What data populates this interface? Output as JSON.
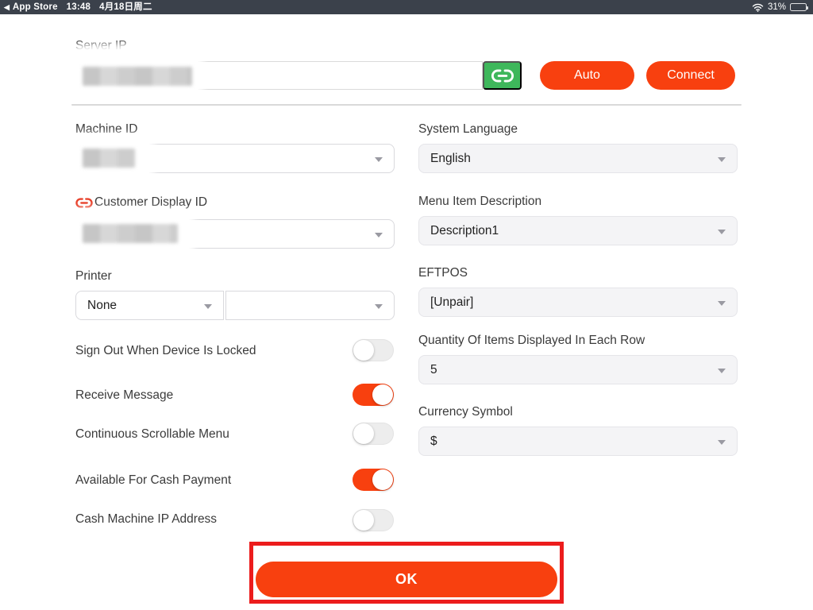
{
  "status_bar": {
    "back_indicator": "◀",
    "back_app": "App Store",
    "time": "13:48",
    "date": "4月18日周二",
    "battery_percent": "31%"
  },
  "colors": {
    "accent_orange": "#f8400f",
    "link_green": "#3eb75b",
    "annotation_red": "#ec1c1c",
    "statusbar_bg": "#3b414b"
  },
  "form": {
    "server_ip": {
      "label": "Server IP",
      "value": "",
      "redacted": true
    },
    "auto_button": "Auto",
    "connect_button": "Connect",
    "machine_id": {
      "label": "Machine ID",
      "value": "",
      "redacted": true
    },
    "customer_display_id": {
      "label": "Customer Display ID",
      "value": "",
      "redacted": true
    },
    "printer": {
      "label": "Printer",
      "value1": "None",
      "value2": ""
    },
    "toggles": [
      {
        "label": "Sign Out When Device Is Locked",
        "on": false
      },
      {
        "label": "Receive Message",
        "on": true
      },
      {
        "label": "Continuous Scrollable Menu",
        "on": false
      },
      {
        "label": "Available For Cash Payment",
        "on": true
      },
      {
        "label": "Cash Machine IP Address",
        "on": false
      }
    ],
    "system_language": {
      "label": "System Language",
      "value": "English"
    },
    "menu_item_description": {
      "label": "Menu Item Description",
      "value": "Description1"
    },
    "eftpos": {
      "label": "EFTPOS",
      "value": "[Unpair]"
    },
    "quantity_per_row": {
      "label": "Quantity Of Items Displayed In Each Row",
      "value": "5"
    },
    "currency_symbol": {
      "label": "Currency Symbol",
      "value": "$"
    },
    "ok_button": "OK"
  }
}
